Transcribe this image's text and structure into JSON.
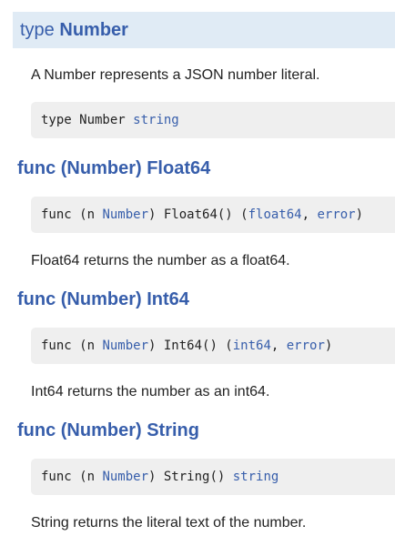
{
  "type_section": {
    "keyword": "type",
    "name": "Number",
    "description": "A Number represents a JSON number literal.",
    "code": {
      "prefix": "type Number ",
      "underlying": "string"
    }
  },
  "methods": [
    {
      "title": "func (Number) Float64",
      "code": {
        "part1": "func (n ",
        "receiver": "Number",
        "part2": ") Float64() (",
        "ret1": "float64",
        "sep": ", ",
        "ret2": "error",
        "part3": ")"
      },
      "description": "Float64 returns the number as a float64."
    },
    {
      "title": "func (Number) Int64",
      "code": {
        "part1": "func (n ",
        "receiver": "Number",
        "part2": ") Int64() (",
        "ret1": "int64",
        "sep": ", ",
        "ret2": "error",
        "part3": ")"
      },
      "description": "Int64 returns the number as an int64."
    },
    {
      "title": "func (Number) String",
      "code": {
        "part1": "func (n ",
        "receiver": "Number",
        "part2": ") String() ",
        "ret1": "string"
      },
      "description": "String returns the literal text of the number."
    }
  ],
  "colors": {
    "link": "#375eab",
    "header_bg": "#e0ebf5",
    "code_bg": "#efefef",
    "text": "#222222"
  }
}
